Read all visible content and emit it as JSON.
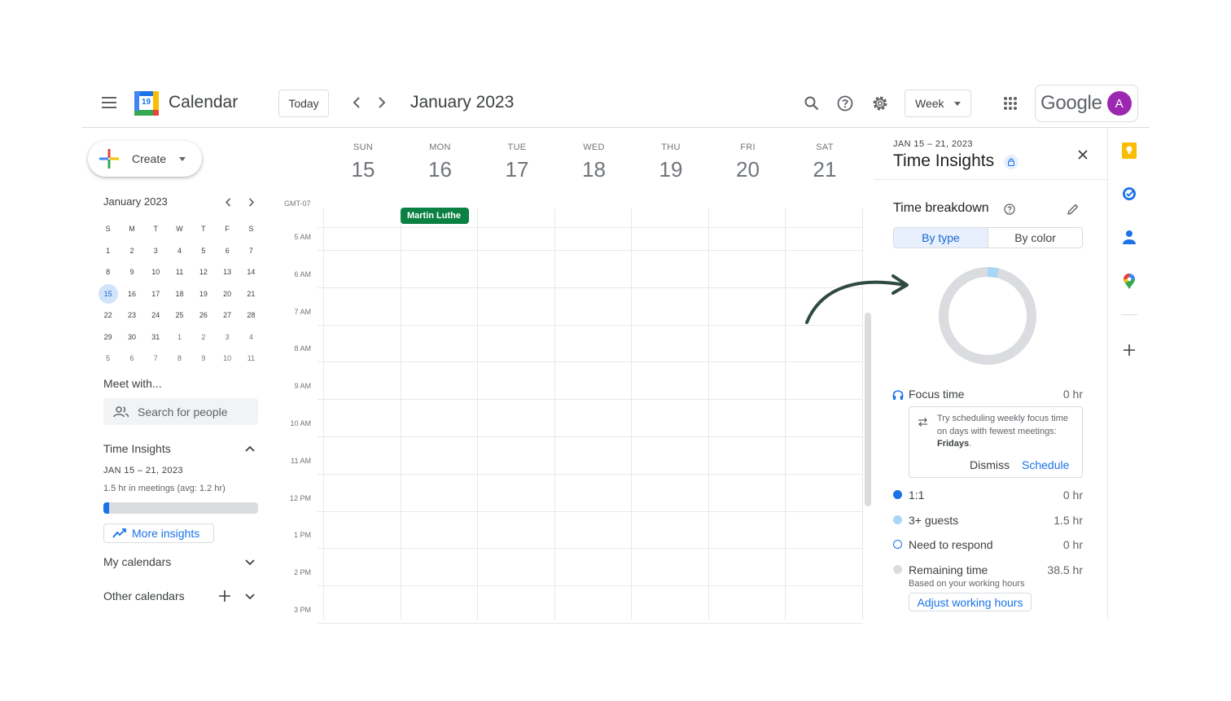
{
  "header": {
    "app_title": "Calendar",
    "logo_day": "19",
    "today_label": "Today",
    "month_title": "January 2023",
    "view_label": "Week",
    "google_word": "Google",
    "avatar_letter": "A"
  },
  "sidebar": {
    "create_label": "Create",
    "mini_calendar": {
      "title": "January 2023",
      "weekdays": [
        "S",
        "M",
        "T",
        "W",
        "T",
        "F",
        "S"
      ],
      "weeks": [
        [
          "1",
          "2",
          "3",
          "4",
          "5",
          "6",
          "7"
        ],
        [
          "8",
          "9",
          "10",
          "11",
          "12",
          "13",
          "14"
        ],
        [
          "15",
          "16",
          "17",
          "18",
          "19",
          "20",
          "21"
        ],
        [
          "22",
          "23",
          "24",
          "25",
          "26",
          "27",
          "28"
        ],
        [
          "29",
          "30",
          "31",
          "1",
          "2",
          "3",
          "4"
        ],
        [
          "5",
          "6",
          "7",
          "8",
          "9",
          "10",
          "11"
        ]
      ],
      "selected": "15"
    },
    "meet_title": "Meet with...",
    "search_people_placeholder": "Search for people",
    "time_insights": {
      "title": "Time Insights",
      "dates": "JAN 15 – 21, 2023",
      "meetings_text": "1.5 hr in meetings (avg: 1.2 hr)",
      "meeting_fraction": 0.039,
      "more_insights_label": "More insights"
    },
    "my_calendars_label": "My calendars",
    "other_calendars_label": "Other calendars"
  },
  "week": {
    "timezone": "GMT-07",
    "days": [
      {
        "name": "SUN",
        "date": "15"
      },
      {
        "name": "MON",
        "date": "16"
      },
      {
        "name": "TUE",
        "date": "17"
      },
      {
        "name": "WED",
        "date": "18"
      },
      {
        "name": "THU",
        "date": "19"
      },
      {
        "name": "FRI",
        "date": "20"
      },
      {
        "name": "SAT",
        "date": "21"
      }
    ],
    "hours": [
      "5 AM",
      "6 AM",
      "7 AM",
      "8 AM",
      "9 AM",
      "10 AM",
      "11 AM",
      "12 PM",
      "1 PM",
      "2 PM",
      "3 PM"
    ],
    "event": {
      "title": "Martin Luthe",
      "day": "MON"
    }
  },
  "insights_panel": {
    "dates": "JAN 15 – 21, 2023",
    "title": "Time Insights",
    "breakdown_title": "Time breakdown",
    "tabs": [
      "By type",
      "By color"
    ],
    "active_tab": "By type",
    "focus": {
      "label": "Focus time",
      "value": "0 hr"
    },
    "tip": {
      "text_before": "Try scheduling weekly focus time on days with fewest meetings: ",
      "day": "Fridays",
      "text_after": ".",
      "dismiss_label": "Dismiss",
      "schedule_label": "Schedule"
    },
    "rows": [
      {
        "label": "1:1",
        "value": "0 hr",
        "color": "#1a73e8"
      },
      {
        "label": "3+ guests",
        "value": "1.5 hr",
        "color": "#a8d6f7"
      },
      {
        "label": "Need to respond",
        "value": "0 hr",
        "color": "#1a73e8"
      },
      {
        "label": "Remaining time",
        "value": "38.5 hr",
        "color": "#dadce0"
      }
    ],
    "remaining_note": "Based on your working hours",
    "adjust_label": "Adjust working hours",
    "donut_fraction_3plus": 0.0375
  },
  "right_rail": {
    "icons": [
      "keep-icon",
      "tasks-icon",
      "contacts-icon",
      "maps-icon",
      "add-icon"
    ]
  },
  "colors": {
    "accent": "#1a73e8",
    "event_green": "#0b8043",
    "arrow": "#2f4a3f",
    "keep_yellow": "#fbbc04"
  }
}
